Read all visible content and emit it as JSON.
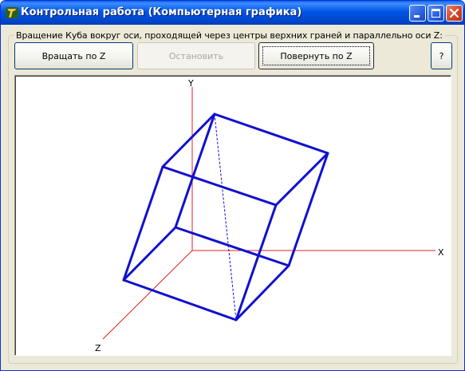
{
  "window": {
    "title": "Контрольная работа (Компьютерная графика)"
  },
  "group": {
    "label": "Вращение Куба вокруг оси, проходящей через центры верхних граней и параллельно оси Z:"
  },
  "buttons": {
    "rotate_z": "Вращать по Z",
    "stop": "Остановить",
    "turn_z": "Повернуть по Z",
    "help": "?"
  },
  "canvas": {
    "axis_x": "X",
    "axis_y": "Y",
    "axis_z": "Z",
    "axis_color": "#e02020",
    "cube_color": "#1010d0"
  }
}
